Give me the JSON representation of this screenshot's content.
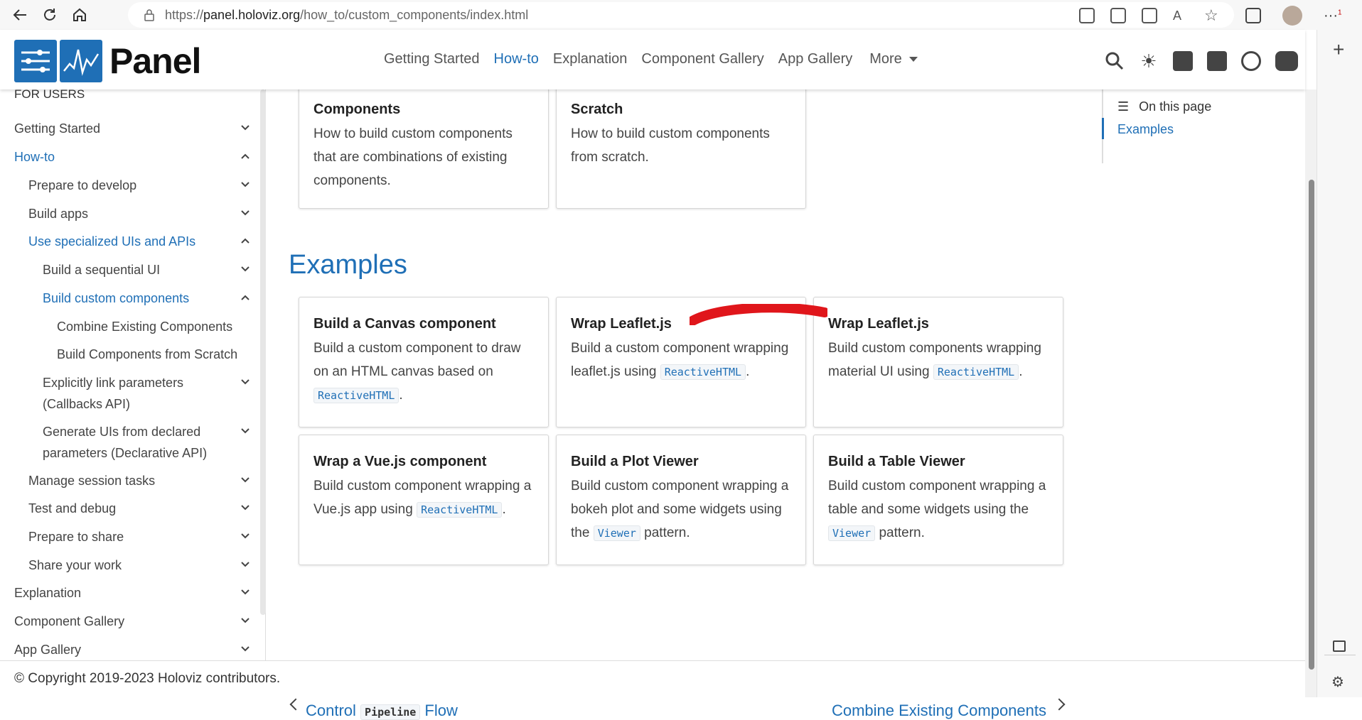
{
  "browser": {
    "url_prefix": "https://",
    "url_domain": "panel.holoviz.org",
    "url_path": "/how_to/custom_components/index.html",
    "notification_count": "1"
  },
  "header": {
    "logo_text": "Panel",
    "nav": [
      {
        "label": "Getting Started"
      },
      {
        "label": "How-to"
      },
      {
        "label": "Explanation"
      },
      {
        "label": "Component Gallery"
      },
      {
        "label": "App Gallery"
      },
      {
        "label": "More"
      }
    ]
  },
  "sidebar": {
    "section_label": "FOR USERS",
    "items": [
      {
        "label": "Getting Started"
      },
      {
        "label": "How-to"
      },
      {
        "label": "Prepare to develop"
      },
      {
        "label": "Build apps"
      },
      {
        "label": "Use specialized UIs and APIs"
      },
      {
        "label": "Build a sequential UI"
      },
      {
        "label": "Build custom components"
      },
      {
        "label": "Combine Existing Components"
      },
      {
        "label": "Build Components from Scratch"
      },
      {
        "label": "Explicitly link parameters"
      },
      {
        "label": "(Callbacks API)"
      },
      {
        "label": "Generate UIs from declared"
      },
      {
        "label": "parameters (Declarative API)"
      },
      {
        "label": "Manage session tasks"
      },
      {
        "label": "Test and debug"
      },
      {
        "label": "Prepare to share"
      },
      {
        "label": "Share your work"
      },
      {
        "label": "Explanation"
      },
      {
        "label": "Component Gallery"
      },
      {
        "label": "App Gallery"
      }
    ]
  },
  "toc": {
    "title": "On this page",
    "items": [
      {
        "label": "Examples"
      }
    ]
  },
  "top_cards": [
    {
      "title": "Components",
      "desc": "How to build custom components that are combinations of existing components."
    },
    {
      "title": "Scratch",
      "desc": "How to build custom components from scratch."
    }
  ],
  "examples": {
    "title": "Examples",
    "cards": [
      {
        "title": "Build a Canvas component",
        "desc": "Build a custom component to draw on an HTML canvas based on",
        "code": "ReactiveHTML",
        "tail": "."
      },
      {
        "title": "Wrap Leaflet.js",
        "desc": "Build a custom component wrapping leaflet.js using",
        "code": "ReactiveHTML",
        "tail": "."
      },
      {
        "title": "Wrap Leaflet.js",
        "desc": "Build custom components wrapping material UI using",
        "code": "ReactiveHTML",
        "tail": "."
      },
      {
        "title": "Wrap a Vue.js component",
        "desc": "Build custom component wrapping a Vue.js app using",
        "code": "ReactiveHTML",
        "tail": "."
      },
      {
        "title": "Build a Plot Viewer",
        "desc": "Build custom component wrapping a bokeh plot and some widgets using the",
        "code": "Viewer",
        "tail": "pattern."
      },
      {
        "title": "Build a Table Viewer",
        "desc": "Build custom component wrapping a table and some widgets using the",
        "code": "Viewer",
        "tail": "pattern."
      }
    ]
  },
  "pager": {
    "prev_label": "Previous",
    "prev_title_a": "Control",
    "prev_title_code": "Pipeline",
    "prev_title_b": "Flow",
    "next_label": "Next",
    "next_title": "Combine Existing Components"
  },
  "footer": {
    "text": "© Copyright 2019-2023 Holoviz contributors."
  },
  "colors": {
    "accent": "#1f6fb6",
    "annotation": "#e0161b"
  }
}
